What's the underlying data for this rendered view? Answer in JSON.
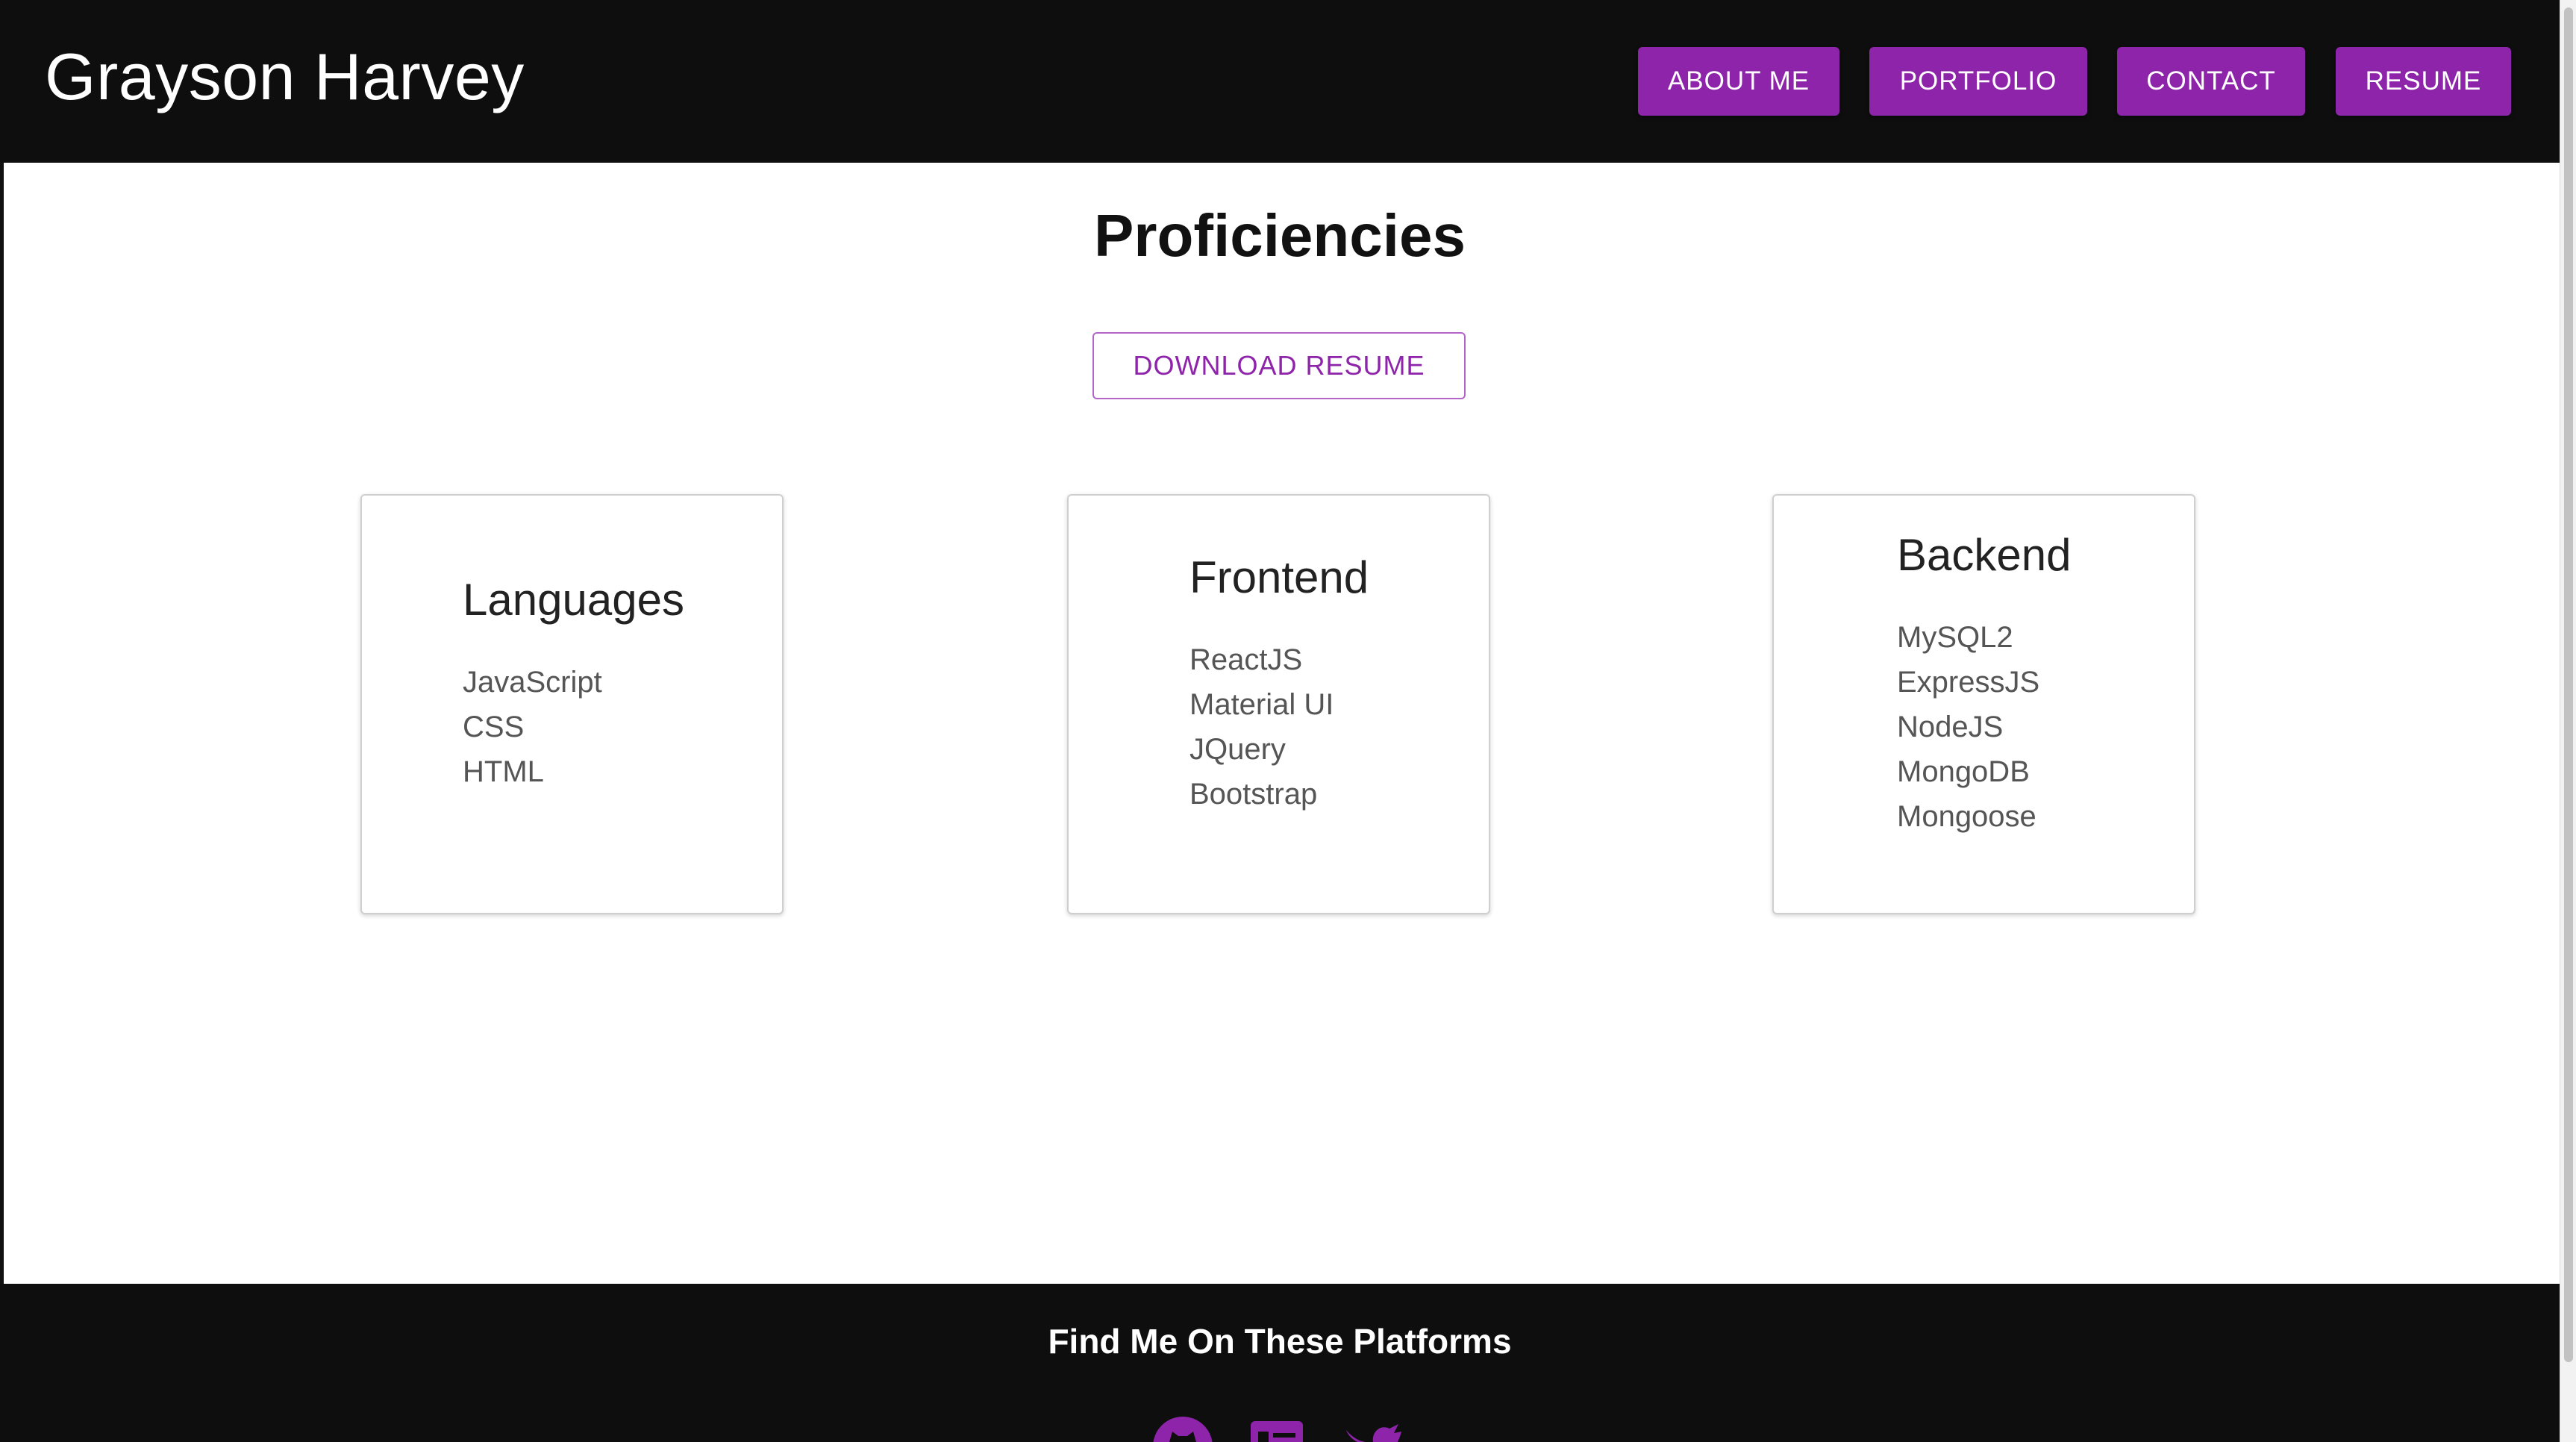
{
  "header": {
    "site_title": "Grayson Harvey",
    "nav": [
      {
        "label": "ABOUT ME"
      },
      {
        "label": "PORTFOLIO"
      },
      {
        "label": "CONTACT"
      },
      {
        "label": "RESUME"
      }
    ]
  },
  "main": {
    "title": "Proficiencies",
    "download_label": "DOWNLOAD RESUME",
    "cards": [
      {
        "title": "Languages",
        "items": [
          "JavaScript",
          "CSS",
          "HTML"
        ]
      },
      {
        "title": "Frontend",
        "items": [
          "ReactJS",
          "Material UI",
          "JQuery",
          "Bootstrap"
        ]
      },
      {
        "title": "Backend",
        "items": [
          "MySQL2",
          "ExpressJS",
          "NodeJS",
          "MongoDB",
          "Mongoose"
        ]
      }
    ]
  },
  "footer": {
    "heading": "Find Me On These Platforms",
    "icons": [
      "github-icon",
      "portfolio-icon",
      "twitter-icon"
    ]
  },
  "colors": {
    "accent": "#8e24aa",
    "header_bg": "#0e0e0e",
    "footer_bg": "#0e0e0e"
  }
}
